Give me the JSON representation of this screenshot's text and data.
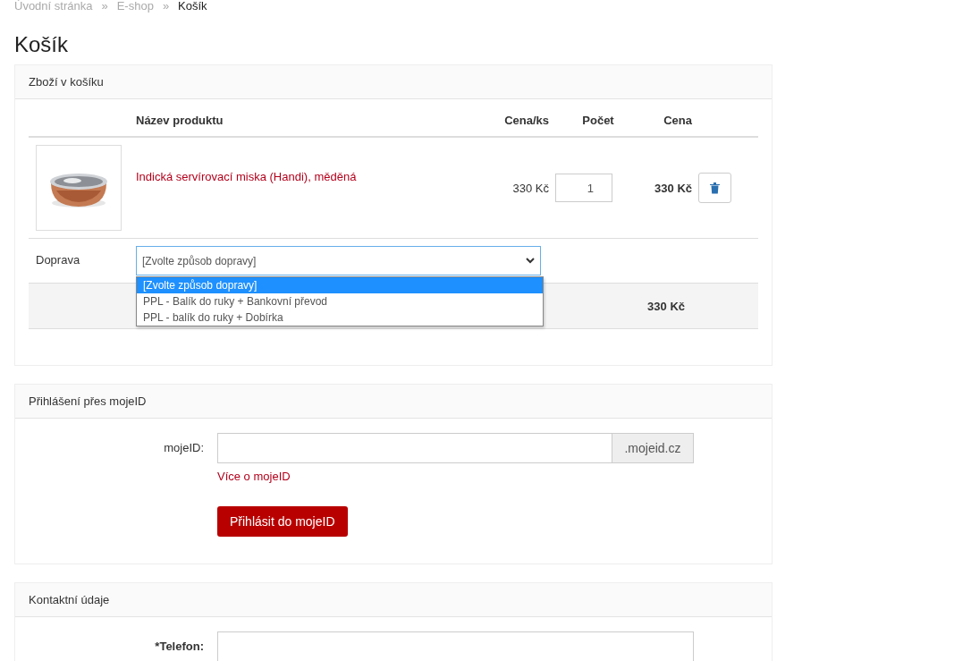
{
  "breadcrumb": [
    {
      "label": "Úvodní stránka",
      "current": false
    },
    {
      "label": "»",
      "current": false
    },
    {
      "label": "E-shop",
      "current": false
    },
    {
      "label": "»",
      "current": false
    },
    {
      "label": "Košík",
      "current": true
    }
  ],
  "title": "Košík",
  "cart": {
    "heading": "Zboží v košíku",
    "columns": [
      "Název produktu",
      "Cena/ks",
      "Počet",
      "Cena"
    ],
    "items": [
      {
        "name": "Indická servírovací miska (Handi), měděná",
        "unit_price": "330 Kč",
        "quantity": "1",
        "price": "330 Kč"
      }
    ],
    "shipping": {
      "label": "Doprava",
      "value": "[Zvolte způsob dopravy]",
      "expanded": true,
      "options": [
        {
          "label": "[Zvolte způsob dopravy]",
          "selected": true
        },
        {
          "label": "PPL - Balík do ruky + Bankovní převod",
          "selected": false
        },
        {
          "label": "PPL - balík do ruky + Dobírka",
          "selected": false
        }
      ]
    },
    "total": "330 Kč"
  },
  "mojeid": {
    "heading": "Přihlášení přes mojeID",
    "label": "mojeID:",
    "suffix": ".mojeid.cz",
    "link": "Více o mojeID",
    "button": "Přihlásit do mojeID"
  },
  "contact": {
    "heading": "Kontaktní údaje",
    "fields": [
      {
        "label": "*Telefon:"
      }
    ]
  }
}
